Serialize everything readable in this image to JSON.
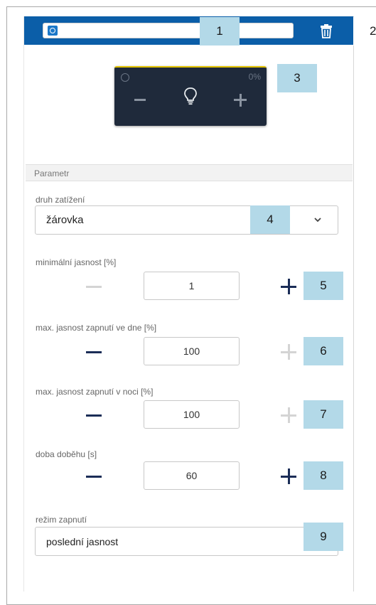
{
  "header": {
    "name_value": ""
  },
  "callouts": [
    "1",
    "2",
    "3",
    "4",
    "5",
    "6",
    "7",
    "8",
    "9"
  ],
  "tile": {
    "percent": "0%"
  },
  "section": {
    "label": "Parametr"
  },
  "load_type": {
    "label": "druh zatížení",
    "value": "žárovka"
  },
  "min_brightness": {
    "label": "minimální jasnost [%]",
    "value": "1"
  },
  "max_day": {
    "label": "max. jasnost zapnutí ve dne [%]",
    "value": "100"
  },
  "max_night": {
    "label": "max. jasnost zapnutí v noci [%]",
    "value": "100"
  },
  "run_on": {
    "label": "doba doběhu [s]",
    "value": "60"
  },
  "mode": {
    "label": "režim zapnutí",
    "value": "poslední jasnost"
  },
  "colors": {
    "header": "#0b5ea8",
    "tile": "#1f2a3b",
    "tile_accent": "#e4c300",
    "callout": "#b3d9e8",
    "active_button": "#1b2d57",
    "disabled_button": "#d4d4d4"
  },
  "icons": {
    "header": "brand-badge-icon",
    "name": "channel-icon",
    "delete": "trash-icon",
    "bulb": "light-bulb-icon",
    "dropdown": "chevron-down-icon"
  }
}
